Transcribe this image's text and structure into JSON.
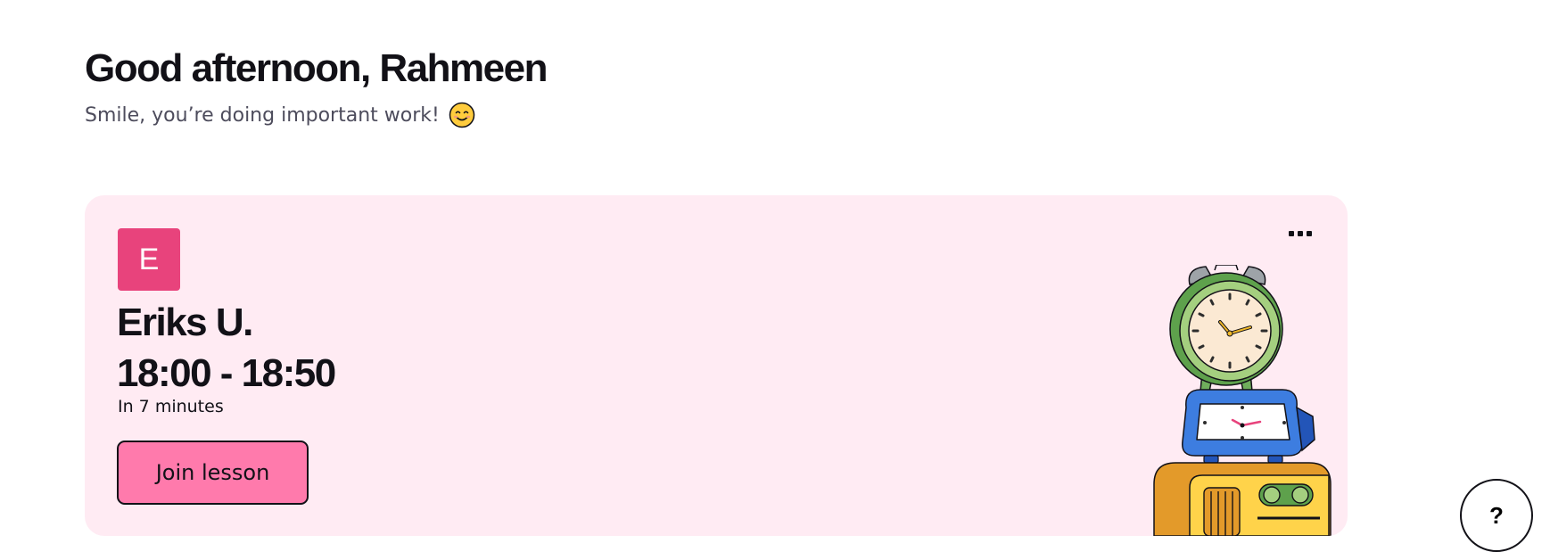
{
  "header": {
    "greeting": "Good afternoon, Rahmeen",
    "subtitle": "Smile, you’re doing important work!",
    "subtitle_icon": "smiling-face-icon"
  },
  "lesson_card": {
    "avatar_letter": "E",
    "tutor_name": "Eriks U.",
    "time_range": "18:00 - 18:50",
    "countdown": "In 7 minutes",
    "join_label": "Join lesson",
    "more_icon": "more-options-icon",
    "illustration": "clocks-illustration"
  },
  "help": {
    "label": "?"
  },
  "colors": {
    "card_background": "#ffebf3",
    "avatar_background": "#e8437c",
    "button_background": "#ff7aac",
    "text": "#121117",
    "muted_text": "#4d4c5c"
  }
}
